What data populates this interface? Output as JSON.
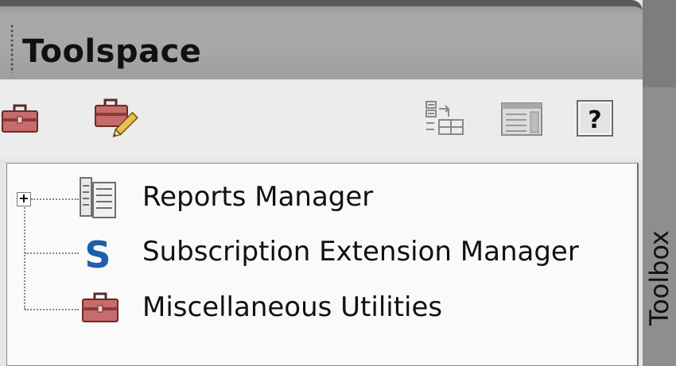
{
  "window": {
    "title": "Toolspace"
  },
  "toolbar": {
    "icons": [
      "toolbox-icon",
      "edit-toolbox-icon",
      "copy-to-toolbox-icon",
      "properties-icon",
      "help-icon"
    ],
    "help_glyph": "?"
  },
  "tree": {
    "items": [
      {
        "label": "Reports Manager",
        "icon": "reports-manager-icon",
        "expandable": true
      },
      {
        "label": "Subscription Extension Manager",
        "icon": "subscription-extension-icon",
        "expandable": false
      },
      {
        "label": "Miscellaneous Utilities",
        "icon": "toolbox-icon",
        "expandable": false
      }
    ],
    "expander_glyph": "+",
    "subscription_glyph": "S"
  },
  "side_tab": {
    "label": "Toolbox"
  },
  "colors": {
    "toolbox_red": "#c85a5a",
    "subscription_blue": "#1f5fa8"
  }
}
